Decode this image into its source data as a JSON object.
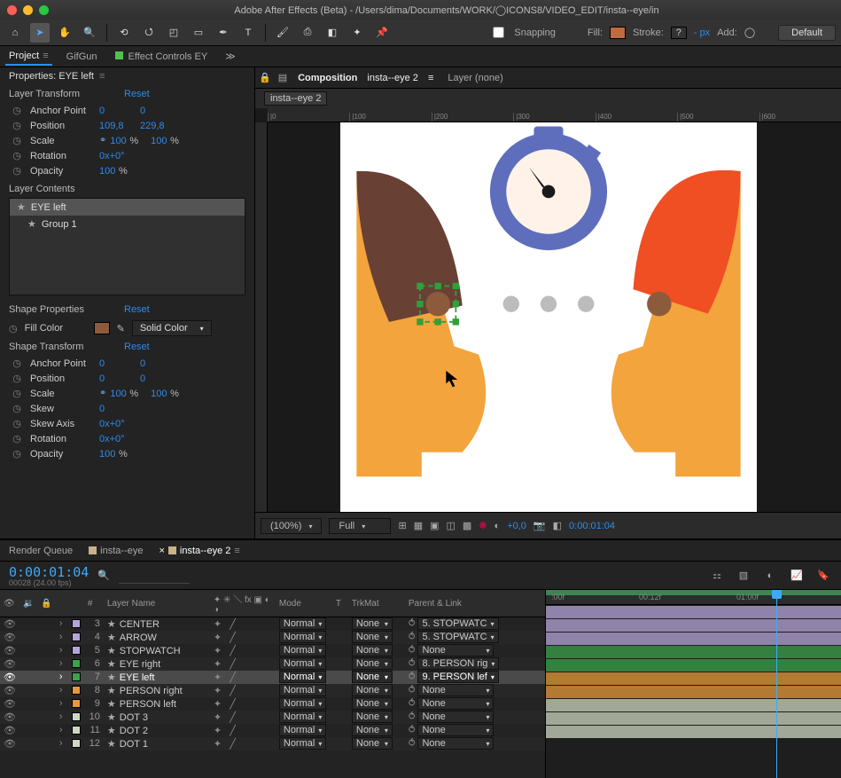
{
  "app_title": "Adobe After Effects (Beta) - /Users/dima/Documents/WORK/◯ICONS8/VIDEO_EDIT/insta--eye/in",
  "toolbar_right": {
    "snapping": "Snapping",
    "fill": "Fill:",
    "stroke": "Stroke:",
    "stroke_val": "?",
    "stroke_px": "- px",
    "add": "Add:",
    "add_val": "◯",
    "workspace": "Default"
  },
  "panel_tabs": {
    "project": "Project",
    "gifgun": "GifGun",
    "effect_controls": "Effect Controls EY",
    "more": "≫"
  },
  "properties": {
    "title": "Properties: EYE left",
    "layer_transform": "Layer Transform",
    "reset": "Reset",
    "anchor_point": {
      "label": "Anchor Point",
      "x": "0",
      "y": "0"
    },
    "position": {
      "label": "Position",
      "x": "109,8",
      "y": "229,8"
    },
    "scale": {
      "label": "Scale",
      "x": "100",
      "y": "100",
      "pct": "%"
    },
    "rotation": {
      "label": "Rotation",
      "v": "0x+0°"
    },
    "opacity": {
      "label": "Opacity",
      "v": "100",
      "pct": "%"
    },
    "layer_contents": "Layer Contents",
    "contents": [
      "EYE left",
      "Group 1"
    ],
    "shape_properties": "Shape Properties",
    "fill_color": "Fill Color",
    "fill_type": "Solid Color",
    "shape_transform": "Shape Transform",
    "st_anchor": {
      "label": "Anchor Point",
      "x": "0",
      "y": "0"
    },
    "st_position": {
      "label": "Position",
      "x": "0",
      "y": "0"
    },
    "st_scale": {
      "label": "Scale",
      "x": "100",
      "y": "100",
      "pct": "%"
    },
    "st_skew": {
      "label": "Skew",
      "v": "0"
    },
    "st_skew_axis": {
      "label": "Skew Axis",
      "v": "0x+0°"
    },
    "st_rotation": {
      "label": "Rotation",
      "v": "0x+0°"
    },
    "st_opacity": {
      "label": "Opacity",
      "v": "100",
      "pct": "%"
    }
  },
  "viewer": {
    "comp_label": "Composition",
    "comp_name": "insta--eye 2",
    "layer_label": "Layer (none)",
    "subtab": "insta--eye 2",
    "mag": "(100%)",
    "res": "Full",
    "exposure": "+0,0",
    "time": "0:00:01:04"
  },
  "timeline": {
    "tab_rq": "Render Queue",
    "tab_c1": "insta--eye",
    "tab_c2": "insta--eye 2",
    "timecode": "0:00:01:04",
    "timecode_sub": "00028 (24.00 fps)",
    "cols": {
      "num": "#",
      "layer": "Layer Name",
      "mode": "Mode",
      "t": "T",
      "trkmat": "TrkMat",
      "parent": "Parent & Link"
    },
    "ruler": {
      "t0": ":00f",
      "t1": "00:12f",
      "t2": "01:00f"
    },
    "layers": [
      {
        "n": "3",
        "name": "CENTER",
        "color": "#b6a5d9",
        "mode": "Normal",
        "trk": "None",
        "parent": "5. STOPWATC"
      },
      {
        "n": "4",
        "name": "ARROW",
        "color": "#b6a5d9",
        "mode": "Normal",
        "trk": "None",
        "parent": "5. STOPWATC"
      },
      {
        "n": "5",
        "name": "STOPWATCH",
        "color": "#b6a5d9",
        "mode": "Normal",
        "trk": "None",
        "parent": "None"
      },
      {
        "n": "6",
        "name": "EYE right",
        "color": "#3ba24c",
        "mode": "Normal",
        "trk": "None",
        "parent": "8. PERSON rig"
      },
      {
        "n": "7",
        "name": "EYE left",
        "color": "#3ba24c",
        "mode": "Normal",
        "trk": "None",
        "parent": "9. PERSON lef",
        "sel": true
      },
      {
        "n": "8",
        "name": "PERSON right",
        "color": "#e59a3a",
        "mode": "Normal",
        "trk": "None",
        "parent": "None"
      },
      {
        "n": "9",
        "name": "PERSON left",
        "color": "#e59a3a",
        "mode": "Normal",
        "trk": "None",
        "parent": "None"
      },
      {
        "n": "10",
        "name": "DOT 3",
        "color": "#ced7c1",
        "mode": "Normal",
        "trk": "None",
        "parent": "None"
      },
      {
        "n": "11",
        "name": "DOT 2",
        "color": "#ced7c1",
        "mode": "Normal",
        "trk": "None",
        "parent": "None"
      },
      {
        "n": "12",
        "name": "DOT 1",
        "color": "#ced7c1",
        "mode": "Normal",
        "trk": "None",
        "parent": "None"
      }
    ]
  }
}
